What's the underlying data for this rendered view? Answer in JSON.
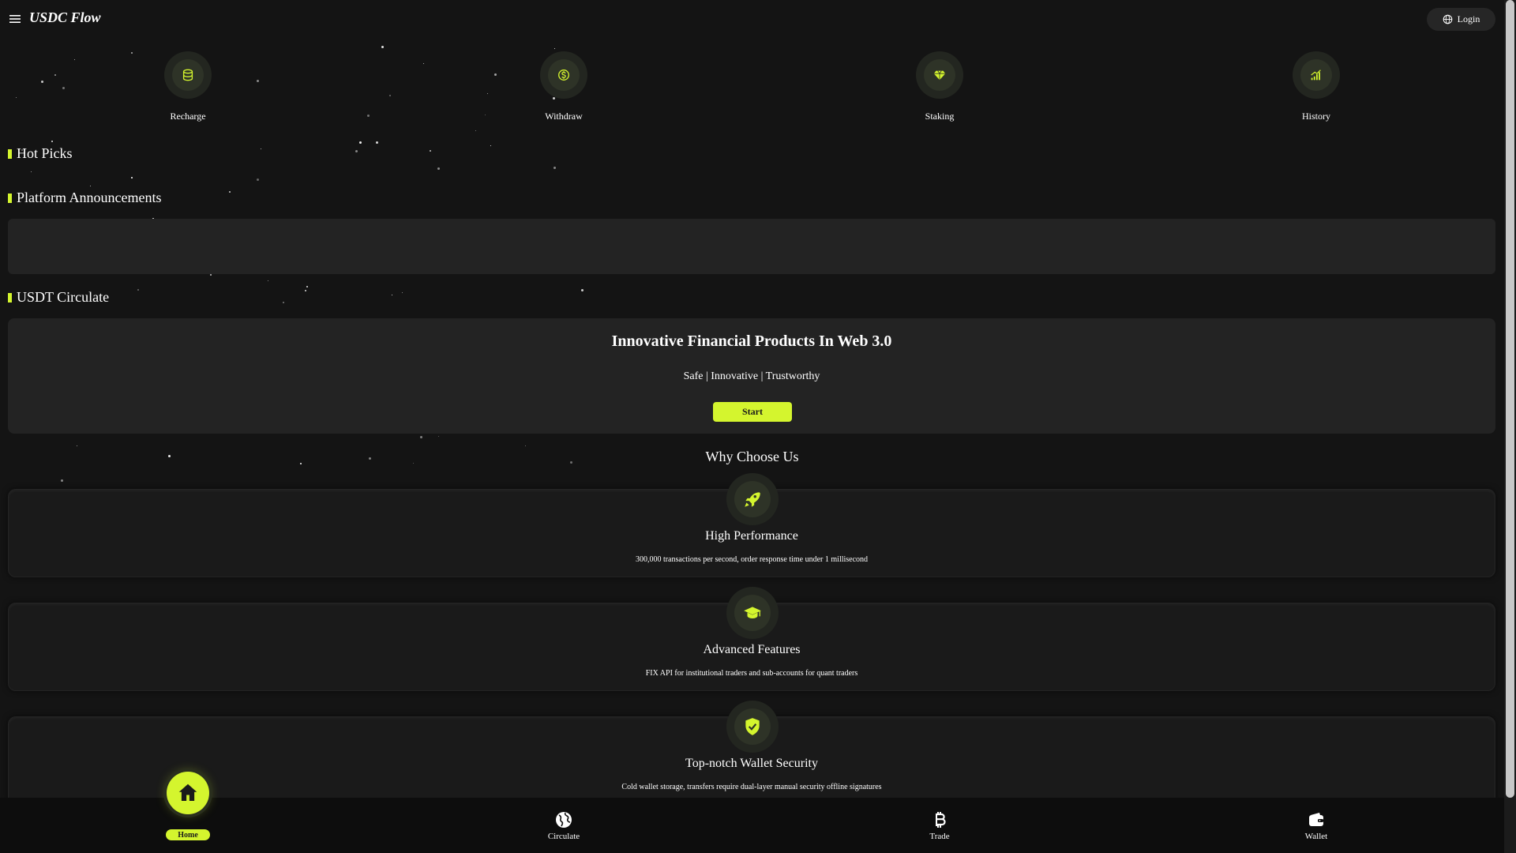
{
  "header": {
    "brand": "USDC Flow",
    "login_label": "Login"
  },
  "quick_actions": [
    {
      "label": "Recharge",
      "icon": "database-icon"
    },
    {
      "label": "Withdraw",
      "icon": "dollar-coin-icon"
    },
    {
      "label": "Staking",
      "icon": "diamond-icon"
    },
    {
      "label": "History",
      "icon": "signal-bars-icon"
    }
  ],
  "sections": {
    "hot_picks": "Hot Picks",
    "announcements": "Platform Announcements",
    "usdt_circulate": "USDT Circulate"
  },
  "hero": {
    "title": "Innovative Financial Products In Web 3.0",
    "subtitle": "Safe | Innovative | Trustworthy",
    "start_label": "Start"
  },
  "why": {
    "title": "Why Choose Us",
    "features": [
      {
        "title": "High Performance",
        "desc": "300,000 transactions per second, order response time under 1 millisecond",
        "icon": "rocket-icon"
      },
      {
        "title": "Advanced Features",
        "desc": "FIX API for institutional traders and sub-accounts for quant traders",
        "icon": "graduation-cap-icon"
      },
      {
        "title": "Top-notch Wallet Security",
        "desc": "Cold wallet storage, transfers require dual-layer manual security offline signatures",
        "icon": "shield-check-icon"
      }
    ]
  },
  "bottom_nav": [
    {
      "label": "Home",
      "icon": "home-icon",
      "active": true
    },
    {
      "label": "Circulate",
      "icon": "globe-icon",
      "active": false
    },
    {
      "label": "Trade",
      "icon": "bitcoin-icon",
      "active": false
    },
    {
      "label": "Wallet",
      "icon": "wallet-icon",
      "active": false
    }
  ],
  "colors": {
    "background": "#141414",
    "accent": "#d4f52e",
    "card": "#232323"
  }
}
